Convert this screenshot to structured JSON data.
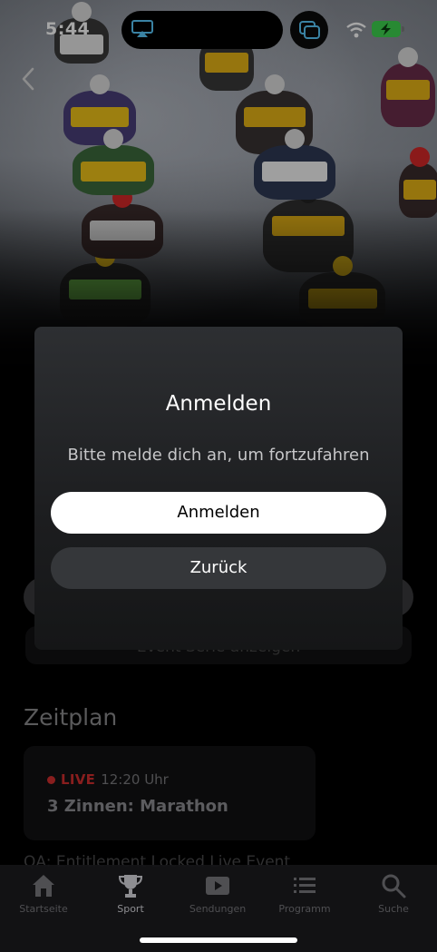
{
  "status_bar": {
    "time": "5:44",
    "icons": [
      "airplay-icon",
      "picture-in-picture-icon",
      "wifi-icon",
      "battery-charging-icon"
    ],
    "battery_color": "#3ed34f"
  },
  "hero": {
    "image_description_icon": "ski-race-photo",
    "back_icon": "chevron-left-icon"
  },
  "modal": {
    "title": "Anmelden",
    "message": "Bitte melde dich an, um fortzufahren",
    "primary_label": "Anmelden",
    "secondary_label": "Zurück"
  },
  "background": {
    "event_series_label": "Event Serie anzeigen",
    "schedule_title": "Zeitplan",
    "schedule_item": {
      "live_label": "LIVE",
      "time": "12:20 Uhr",
      "title": "3 Zinnen: Marathon"
    },
    "qa_text": "QA: Entitlement Locked Live Event"
  },
  "tabbar": {
    "items": [
      {
        "label": "Startseite",
        "icon": "home-icon",
        "active": false
      },
      {
        "label": "Sport",
        "icon": "trophy-icon",
        "active": true
      },
      {
        "label": "Sendungen",
        "icon": "play-icon",
        "active": false
      },
      {
        "label": "Programm",
        "icon": "list-icon",
        "active": false
      },
      {
        "label": "Suche",
        "icon": "search-icon",
        "active": false
      }
    ]
  },
  "colors": {
    "live": "#d32f2f",
    "modal_bg": "#2d2f32",
    "primary_button": "#ffffff"
  }
}
